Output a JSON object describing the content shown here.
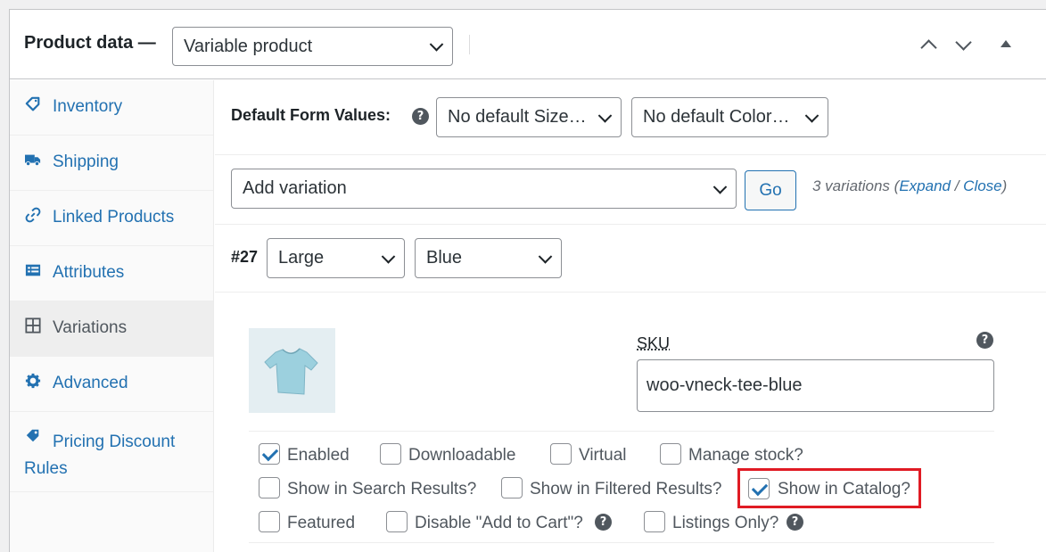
{
  "header": {
    "title": "Product data —",
    "product_type": "Variable product"
  },
  "sidebar": {
    "items": [
      {
        "label": "Inventory",
        "icon": "tag-icon"
      },
      {
        "label": "Shipping",
        "icon": "truck-icon"
      },
      {
        "label": "Linked Products",
        "icon": "link-icon"
      },
      {
        "label": "Attributes",
        "icon": "list-icon"
      },
      {
        "label": "Variations",
        "icon": "grid-icon"
      },
      {
        "label": "Advanced",
        "icon": "gear-icon"
      },
      {
        "label": "Pricing Discount Rules",
        "icon": "tag-icon"
      }
    ],
    "active": "Variations"
  },
  "defaults": {
    "label": "Default Form Values:",
    "size": "No default Size…",
    "color": "No default Color…"
  },
  "toolbar": {
    "action": "Add variation",
    "go": "Go",
    "count_text": "3 variations (",
    "expand": "Expand",
    "slash": " / ",
    "close": "Close",
    "close_paren": ")"
  },
  "variation": {
    "id": "#27",
    "size": "Large",
    "color": "Blue",
    "sku_label": "SKU",
    "sku_value": "woo-vneck-tee-blue"
  },
  "options": [
    {
      "label": "Enabled",
      "checked": true
    },
    {
      "label": "Downloadable",
      "checked": false
    },
    {
      "label": "Virtual",
      "checked": false
    },
    {
      "label": "Manage stock?",
      "checked": false
    },
    {
      "label": "Show in Search Results?",
      "checked": false
    },
    {
      "label": "Show in Filtered Results?",
      "checked": false
    },
    {
      "label": "Show in Catalog?",
      "checked": true
    },
    {
      "label": "Featured",
      "checked": false
    },
    {
      "label": "Disable \"Add to Cart\"?",
      "checked": false
    },
    {
      "label": "Listings Only?",
      "checked": false
    }
  ],
  "colors": {
    "accent": "#2271b1",
    "highlight": "#e01b24"
  }
}
